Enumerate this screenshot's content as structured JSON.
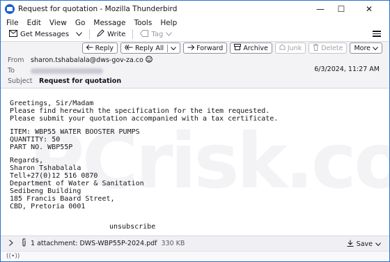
{
  "window": {
    "title": "Request for quotation - Mozilla Thunderbird",
    "minimize": "—",
    "maximize": "☐",
    "close": "✕"
  },
  "menu": [
    "File",
    "Edit",
    "View",
    "Go",
    "Message",
    "Tools",
    "Help"
  ],
  "toolbar": {
    "get_messages": "Get Messages",
    "write": "Write",
    "tag": "Tag"
  },
  "actions": {
    "reply": "Reply",
    "reply_all": "Reply All",
    "forward": "Forward",
    "archive": "Archive",
    "junk": "Junk",
    "delete": "Delete",
    "more": "More"
  },
  "header": {
    "from_label": "From",
    "from_value": "sharon.tshabalala@dws-gov-za.co",
    "to_label": "To",
    "subject_label": "Subject",
    "subject_value": "Request for quotation",
    "date": "6/3/2024, 11:27 AM"
  },
  "body": {
    "greeting": "Greetings, Sir/Madam\nPlease find herewith the specification for the item requested.\nPlease submit your quotation accompanied with a tax certificate.",
    "item": "ITEM: WBP55 WATER BOOSTER PUMPS\nQUANTITY: 50\nPART NO. WBP55P",
    "signature": "Regards,\nSharon Tshabalala\nTell+27(0)12 516 0870\nDepartment of Water & Sanitation\nSedibeng Building\n185 Francis Baard Street,\nCBD, Pretoria 0001",
    "unsubscribe": "unsubscribe"
  },
  "attachment": {
    "label": "1 attachment: DWS-WBP55P-2024.pdf",
    "size": "330 KB",
    "save": "Save"
  },
  "watermark": "PCrisk.com",
  "colors": {
    "accent": "#1f5fd1",
    "header_bg": "#f3f3f5"
  }
}
